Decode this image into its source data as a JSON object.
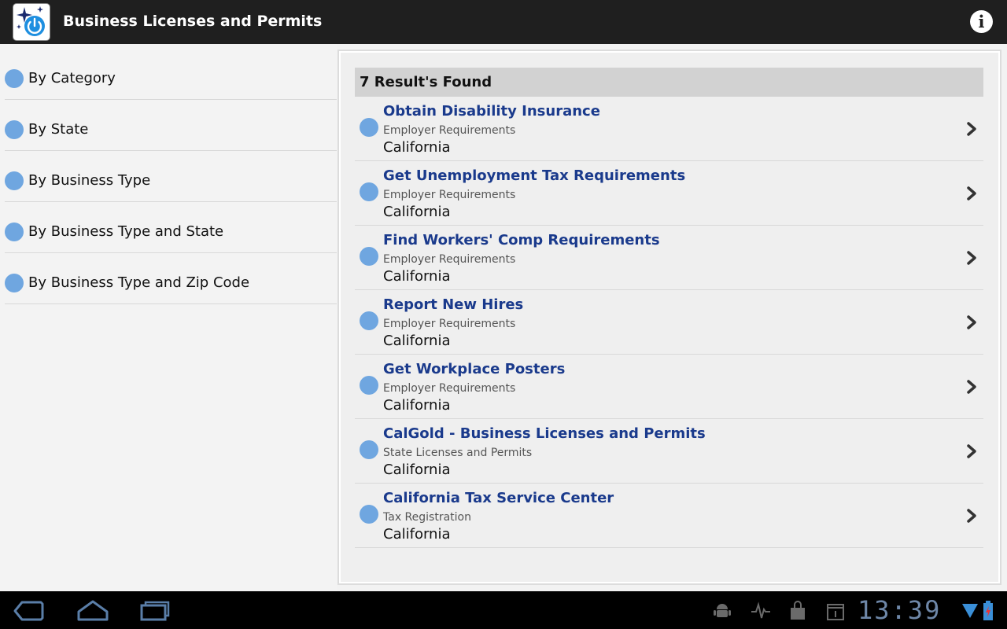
{
  "actionbar": {
    "title": "Business Licenses and Permits",
    "info_glyph": "i"
  },
  "sidebar": {
    "items": [
      {
        "label": "By Category"
      },
      {
        "label": "By State"
      },
      {
        "label": "By Business Type"
      },
      {
        "label": "By Business Type and State"
      },
      {
        "label": "By Business Type and Zip Code"
      }
    ]
  },
  "results": {
    "header": "7 Result's Found",
    "items": [
      {
        "title": "Obtain Disability Insurance",
        "category": "Employer Requirements",
        "location": "California"
      },
      {
        "title": "Get Unemployment Tax Requirements",
        "category": "Employer Requirements",
        "location": "California"
      },
      {
        "title": "Find Workers' Comp Requirements",
        "category": "Employer Requirements",
        "location": "California"
      },
      {
        "title": "Report New Hires",
        "category": "Employer Requirements",
        "location": "California"
      },
      {
        "title": "Get Workplace Posters",
        "category": "Employer Requirements",
        "location": "California"
      },
      {
        "title": "CalGold - Business Licenses and Permits",
        "category": "State Licenses and Permits",
        "location": "California"
      },
      {
        "title": "California Tax Service Center",
        "category": "Tax Registration",
        "location": "California"
      }
    ]
  },
  "statusbar": {
    "clock": "13:39"
  },
  "colors": {
    "actionbar_bg": "#1f1f1f",
    "bullet": "#6fa6e0",
    "title_link": "#1a3a8c",
    "clock": "#6e87a8"
  }
}
